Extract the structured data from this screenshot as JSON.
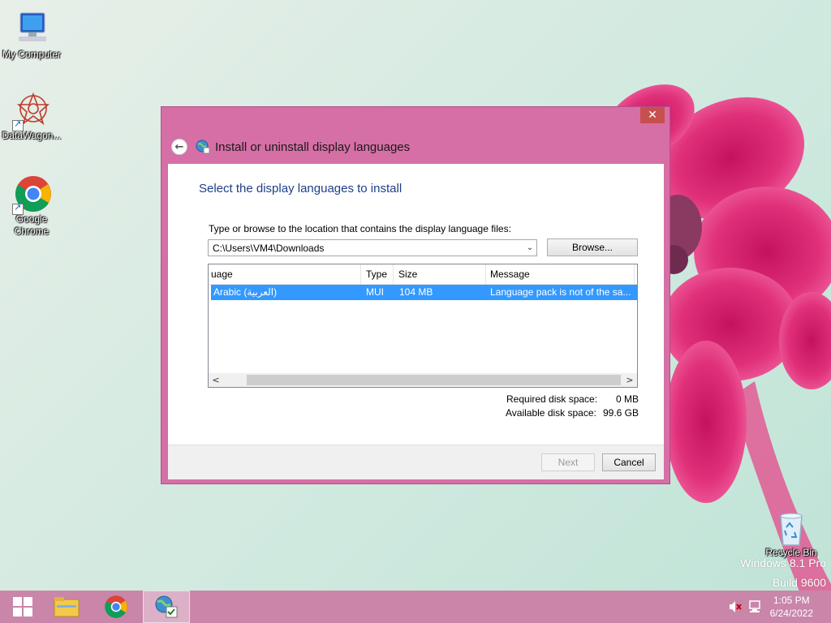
{
  "desktop": {
    "icons": [
      {
        "label": "My Computer"
      },
      {
        "label": "DataWagon..."
      },
      {
        "label": "Google Chrome"
      }
    ],
    "recycle_bin": "Recycle Bin",
    "watermark_line1": "Windows 8.1 Pro",
    "watermark_line2": "Build 9600"
  },
  "dialog": {
    "title": "Install or uninstall display languages",
    "close_glyph": "✕",
    "back_glyph": "←",
    "main_instruction": "Select the display languages to install",
    "path_label": "Type or browse to the location that contains the display language files:",
    "path_value": "C:\\Users\\VM4\\Downloads",
    "browse_label": "Browse...",
    "columns": [
      "uage",
      "Type",
      "Size",
      "Message"
    ],
    "rows": [
      {
        "language": "Arabic (العربية)",
        "type": "MUI",
        "size": "104 MB",
        "message": "Language pack is not of the sa..."
      }
    ],
    "required_label": "Required disk space:",
    "required_value": "0 MB",
    "available_label": "Available disk space:",
    "available_value": "99.6 GB",
    "next_label": "Next",
    "cancel_label": "Cancel"
  },
  "taskbar": {
    "time": "1:05 PM",
    "date": "6/24/2022"
  },
  "colors": {
    "dialog_frame": "#d66fa6",
    "selection": "#3399ff",
    "taskbar": "#c986a9",
    "instruction_text": "#1c3f8a"
  }
}
